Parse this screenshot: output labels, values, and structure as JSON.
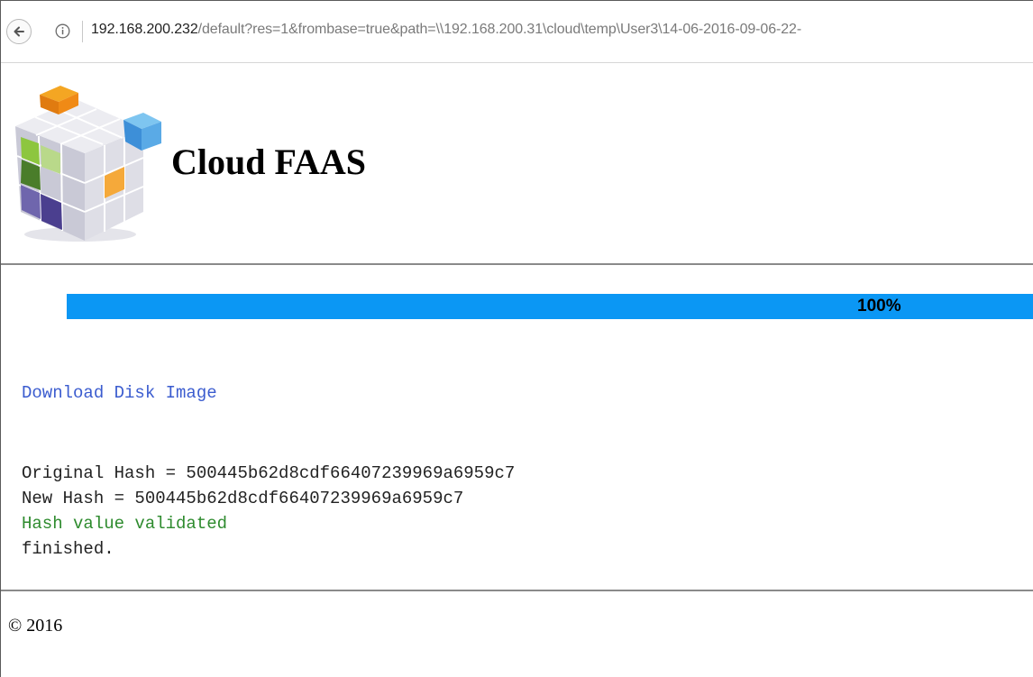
{
  "browser": {
    "back_icon": "back-arrow-icon",
    "info_icon": "info-icon",
    "url_host": "192.168.200.232",
    "url_rest": "/default?res=1&frombase=true&path=\\\\192.168.200.31\\cloud\\temp\\User3\\14-06-2016-09-06-22-"
  },
  "header": {
    "logo_icon": "cube-logo-icon",
    "title": "Cloud FAAS"
  },
  "progress": {
    "percent": 100,
    "label": "100%",
    "color": "#0b97f4"
  },
  "content": {
    "download_link": "Download Disk Image",
    "original_hash": "Original Hash = 500445b62d8cdf66407239969a6959c7",
    "new_hash": "New Hash = 500445b62d8cdf66407239969a6959c7",
    "validation": "Hash value validated",
    "status": "finished."
  },
  "footer": {
    "copyright": "© 2016"
  },
  "colors": {
    "link": "#3b5ccf",
    "success": "#2e8b2e"
  }
}
